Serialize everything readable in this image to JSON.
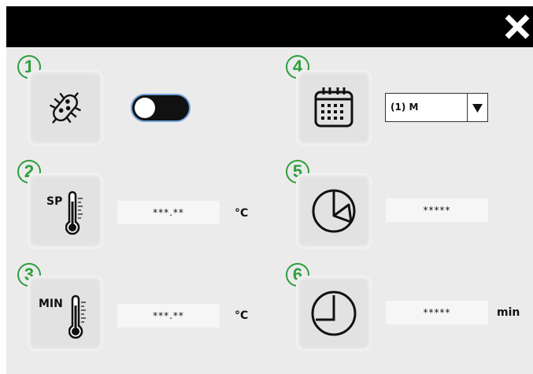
{
  "header": {
    "close_icon": "close-icon"
  },
  "sections": {
    "s1": {
      "number": "1",
      "icon": "bacteria-icon",
      "toggle_state": "off"
    },
    "s2": {
      "number": "2",
      "icon": "thermometer-icon",
      "label": "SP",
      "value": "***.**",
      "unit": "°C"
    },
    "s3": {
      "number": "3",
      "icon": "thermometer-icon",
      "label": "MIN",
      "value": "***.**",
      "unit": "°C"
    },
    "s4": {
      "number": "4",
      "icon": "calendar-icon",
      "dropdown_value": "(1) M"
    },
    "s5": {
      "number": "5",
      "icon": "timer-pie-icon",
      "value": "*****"
    },
    "s6": {
      "number": "6",
      "icon": "clock-icon",
      "value": "*****",
      "unit": "min"
    }
  },
  "colors": {
    "number_green": "#2e9e3c",
    "toggle_border": "#6fa3d8",
    "panel_bg": "#ebebeb",
    "header_bg": "#000000"
  }
}
